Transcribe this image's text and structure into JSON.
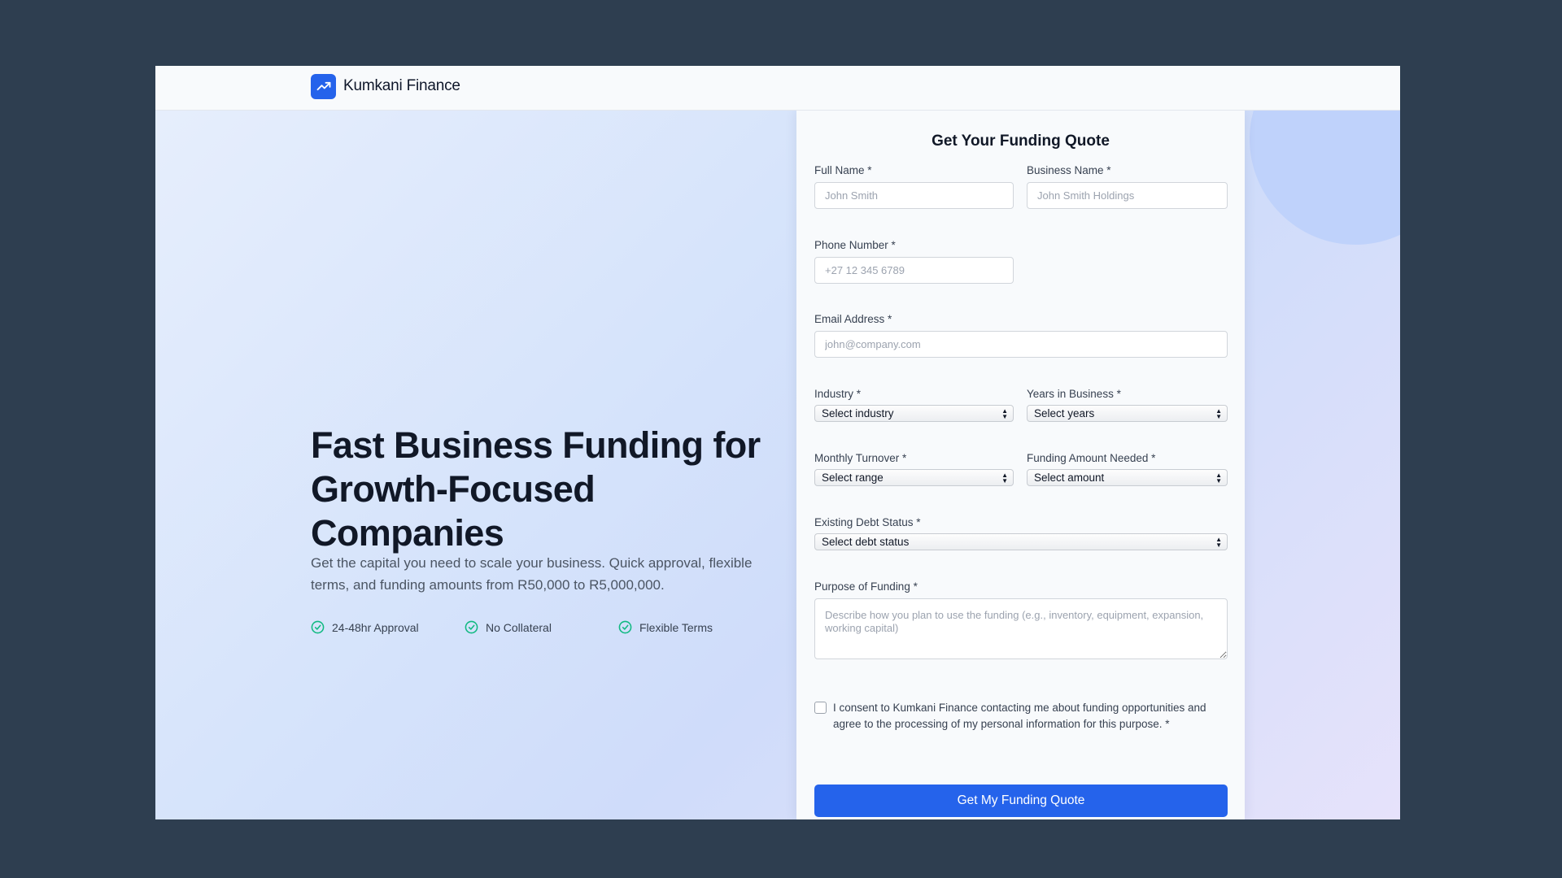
{
  "brand": {
    "name": "Kumkani Finance",
    "logo_icon": "trending-up-icon",
    "accent_color": "#2563eb"
  },
  "hero": {
    "headline": "Fast Business Funding for Growth-Focused Companies",
    "subtext": "Get the capital you need to scale your business. Quick approval, flexible terms, and funding amounts from R50,000 to R5,000,000.",
    "features": [
      {
        "label": "24-48hr Approval",
        "icon": "check-circle-icon"
      },
      {
        "label": "No Collateral",
        "icon": "check-circle-icon"
      },
      {
        "label": "Flexible Terms",
        "icon": "check-circle-icon"
      }
    ],
    "feature_icon_color": "#10b981"
  },
  "form": {
    "title": "Get Your Funding Quote",
    "full_name": {
      "label": "Full Name *",
      "placeholder": "John Smith",
      "value": ""
    },
    "business_name": {
      "label": "Business Name *",
      "placeholder": "John Smith Holdings",
      "value": ""
    },
    "phone": {
      "label": "Phone Number *",
      "placeholder": "+27 12 345 6789",
      "value": ""
    },
    "email": {
      "label": "Email Address *",
      "placeholder": "john@company.com",
      "value": ""
    },
    "industry": {
      "label": "Industry *",
      "selected": "Select industry"
    },
    "years": {
      "label": "Years in Business *",
      "selected": "Select years"
    },
    "turnover": {
      "label": "Monthly Turnover *",
      "selected": "Select range"
    },
    "amount": {
      "label": "Funding Amount Needed *",
      "selected": "Select amount"
    },
    "debt": {
      "label": "Existing Debt Status *",
      "selected": "Select debt status"
    },
    "purpose": {
      "label": "Purpose of Funding *",
      "placeholder": "Describe how you plan to use the funding (e.g., inventory, equipment, expansion, working capital)",
      "value": ""
    },
    "consent": {
      "text": "I consent to Kumkani Finance contacting me about funding opportunities and agree to the processing of my personal information for this purpose. *",
      "checked": false
    },
    "submit_label": "Get My Funding Quote"
  }
}
